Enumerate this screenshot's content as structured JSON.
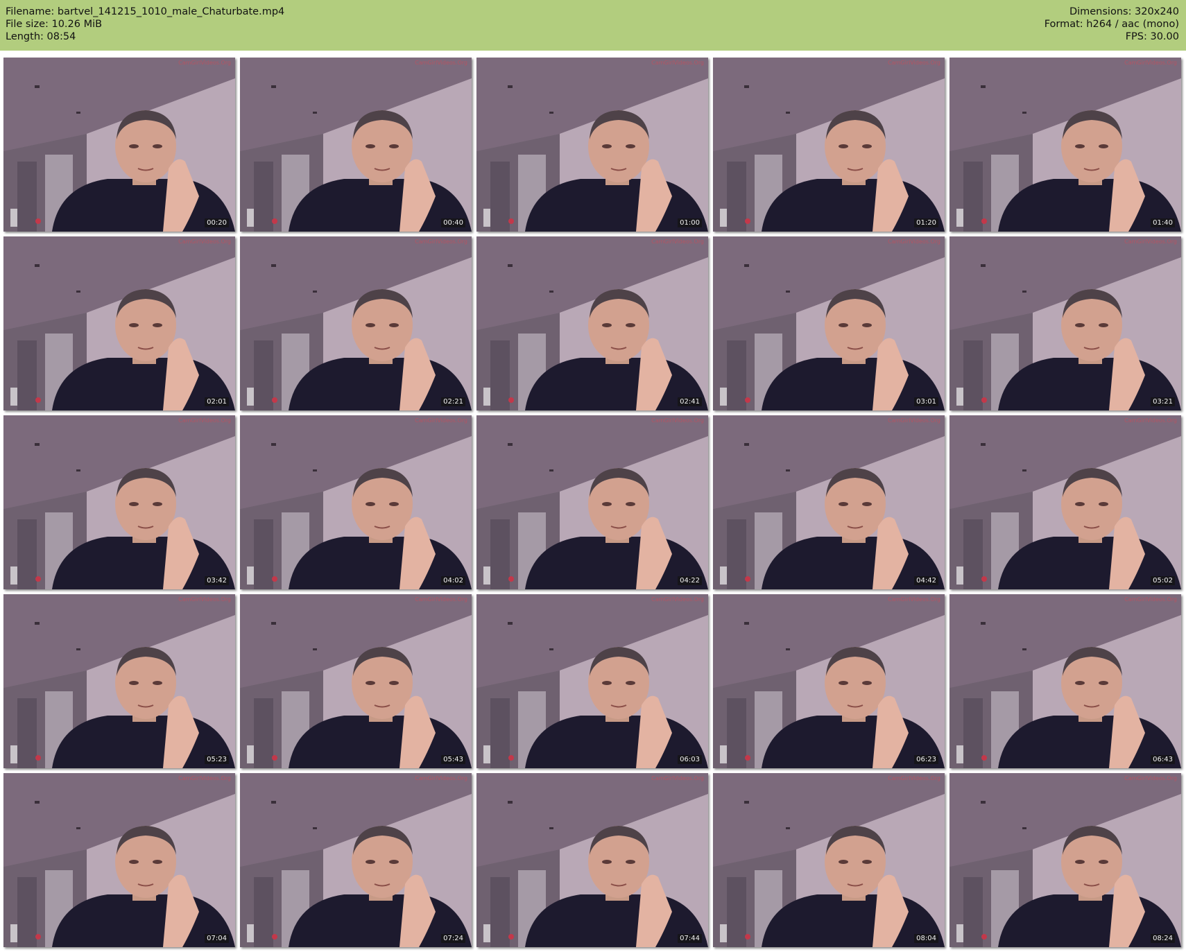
{
  "header": {
    "filename": "Filename: bartvel_141215_1010_male_Chaturbate.mp4",
    "file_size": "File size: 10.26 MiB",
    "length": "Length: 08:54",
    "dimensions": "Dimensions: 320x240",
    "format": "Format: h264 / aac (mono)",
    "fps": "FPS: 30.00"
  },
  "watermark": "CamGirlVideos.Org",
  "colors": {
    "header_bg": "#b2cd7e",
    "timestamp_bg": "#1a1a1a"
  },
  "thumbnails": [
    {
      "time": "00:20"
    },
    {
      "time": "00:40"
    },
    {
      "time": "01:00"
    },
    {
      "time": "01:20"
    },
    {
      "time": "01:40"
    },
    {
      "time": "02:01"
    },
    {
      "time": "02:21"
    },
    {
      "time": "02:41"
    },
    {
      "time": "03:01"
    },
    {
      "time": "03:21"
    },
    {
      "time": "03:42"
    },
    {
      "time": "04:02"
    },
    {
      "time": "04:22"
    },
    {
      "time": "04:42"
    },
    {
      "time": "05:02"
    },
    {
      "time": "05:23"
    },
    {
      "time": "05:43"
    },
    {
      "time": "06:03"
    },
    {
      "time": "06:23"
    },
    {
      "time": "06:43"
    },
    {
      "time": "07:04"
    },
    {
      "time": "07:24"
    },
    {
      "time": "07:44"
    },
    {
      "time": "08:04"
    },
    {
      "time": "08:24"
    }
  ]
}
